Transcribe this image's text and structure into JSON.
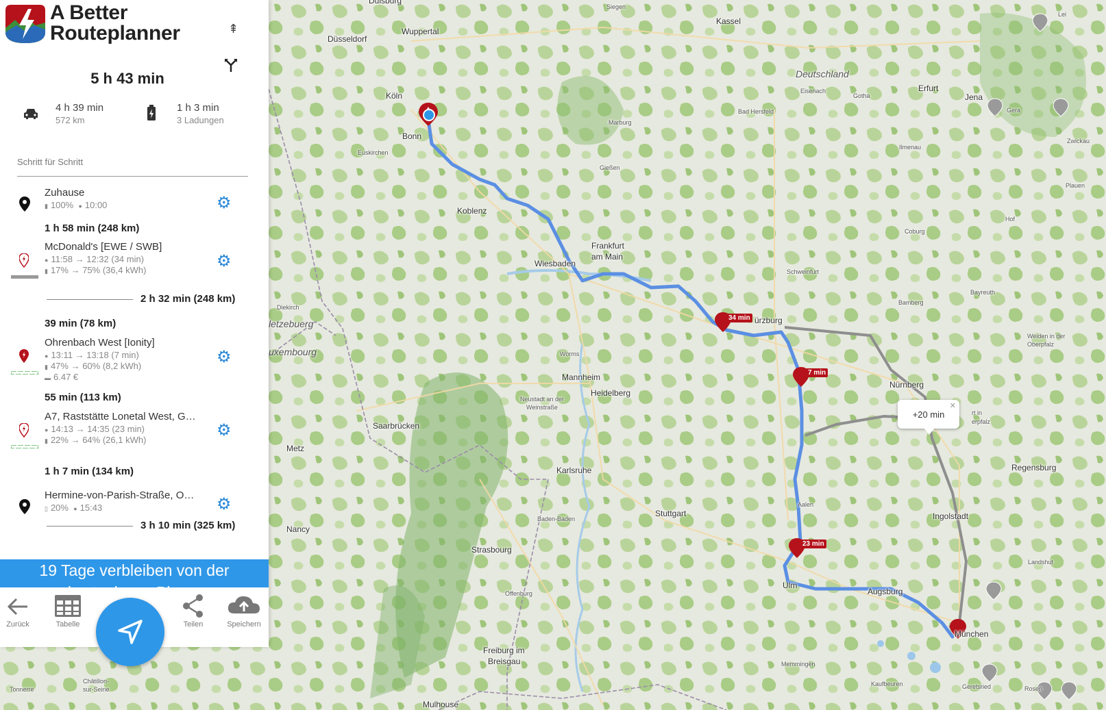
{
  "app": {
    "brand_line1": "A Better",
    "brand_line2": "Routeplanner"
  },
  "summary": {
    "total_time": "5 h 43 min",
    "drive_time": "4 h 39 min",
    "drive_distance": "572 km",
    "charge_time": "1 h 3 min",
    "charge_count": "3 Ladungen"
  },
  "steps_label": "Schritt für Schritt",
  "waypoints": [
    {
      "name": "Zuhause",
      "meta1": "100%   10:00",
      "soc": "100%",
      "time": "10:00"
    },
    {
      "name": "McDonald's [EWE / SWB]",
      "time": "11:58 → 12:32 (34 min)",
      "soc": "17% → 75%  (36,4 kWh)"
    },
    {
      "name": "Ohrenbach West [Ionity]",
      "time": "13:11 → 13:18 (7 min)",
      "soc": "47% → 60%  (8,2 kWh)",
      "cost": "6.47 €"
    },
    {
      "name": "A7, Raststätte Lonetal West, G…",
      "time": "14:13 → 14:35 (23 min)",
      "soc": "22% → 64%  (26,1 kWh)"
    },
    {
      "name": "Hermine-von-Parish-Straße, O…",
      "soc": "20%",
      "time": "15:43"
    }
  ],
  "legs": {
    "leg1": "1 h 58 min (248 km)",
    "group1_total": "2 h 32 min (248 km)",
    "leg2": "39 min (78 km)",
    "leg3": "55 min (113 km)",
    "leg4": "1 h 7 min (134 km)",
    "group2_total": "3 h 10 min (325 km)"
  },
  "banner": {
    "line1": "19 Tage verbleiben von der",
    "line2": "kostenlosen Phase"
  },
  "toolbar": {
    "back": "Zurück",
    "table": "Tabelle",
    "share": "Teilen",
    "save": "Speichern"
  },
  "map": {
    "cities": {
      "duisburg": "Duisburg",
      "siegen": "Siegen",
      "duesseldorf": "Düsseldorf",
      "wuppertal": "Wuppertal",
      "kassel": "Kassel",
      "koeln": "Köln",
      "bonn": "Bonn",
      "euskirchen": "Euskirchen",
      "deutschland": "Deutschland",
      "eisenach": "Eisenach",
      "gotha": "Gotha",
      "erfurt": "Erfurt",
      "jena": "Jena",
      "gera": "Gera",
      "zwickau": "Zwickau",
      "badhersfeld": "Bad Hersfeld",
      "marburg": "Marburg",
      "ilmenau": "Ilmenau",
      "plauen": "Plauen",
      "giessen": "Gießen",
      "koblenz": "Koblenz",
      "coburg": "Coburg",
      "hof": "Hof",
      "frankfurt1": "Frankfurt",
      "frankfurt2": "am Main",
      "wiesbaden": "Wiesbaden",
      "schweinfurt": "Schweinfurt",
      "bayreuth": "Bayreuth",
      "bamberg": "Bamberg",
      "dierkirch": "Diekirch",
      "luxembourg": "uxembourg",
      "luetzebourg": "letzebuerg",
      "wuerzburg": "ürzburg",
      "weiden1": "Weiden in der",
      "weiden2": "Oberpfalz",
      "worms": "Worms",
      "nuernberg": "Nürnberg",
      "mannheim": "Mannheim",
      "heidelberg": "Heidelberg",
      "neustadt1": "Neustadt an der",
      "neustadt2": "Weinstraße",
      "saarbruecken": "Saarbrücken",
      "metz": "Metz",
      "karlsruhe": "Karlsruhe",
      "regensburg": "Regensburg",
      "stuttgart": "Stuttgart",
      "ingolstadt": "Ingolstadt",
      "aalen": "Aalen",
      "nancy": "Nancy",
      "badenbaden": "Baden-Baden",
      "strasbourg": "Strasbourg",
      "landshut": "Landshut",
      "ulm": "Ulm",
      "augsburg": "Augsburg",
      "offenburg": "Offenburg",
      "muenchen": "München",
      "freiburg1": "Freiburg im",
      "freiburg2": "Breisgau",
      "memmingen": "Memmingen",
      "kaufbeuren": "Kaufbeuren",
      "geretsried": "Geretsried",
      "rosenheim": "Rosen",
      "tonnerre": "Tonnerre",
      "chatillon1": "Châtillon-",
      "chatillon2": "sur-Seine",
      "mulhouse": "Mulhouse",
      "leipzig": "Lei",
      "pfalz1": "rt in",
      "pfalz2": "erpfalz"
    },
    "stop_labels": [
      "34 min",
      "7 min",
      "23 min"
    ],
    "alt_bubble": "+20 min",
    "route_color": "#5b8fe3",
    "alt_route_color": "#8e8e8e",
    "brand_red": "#b5121b",
    "accent_blue": "#2f97e8"
  }
}
